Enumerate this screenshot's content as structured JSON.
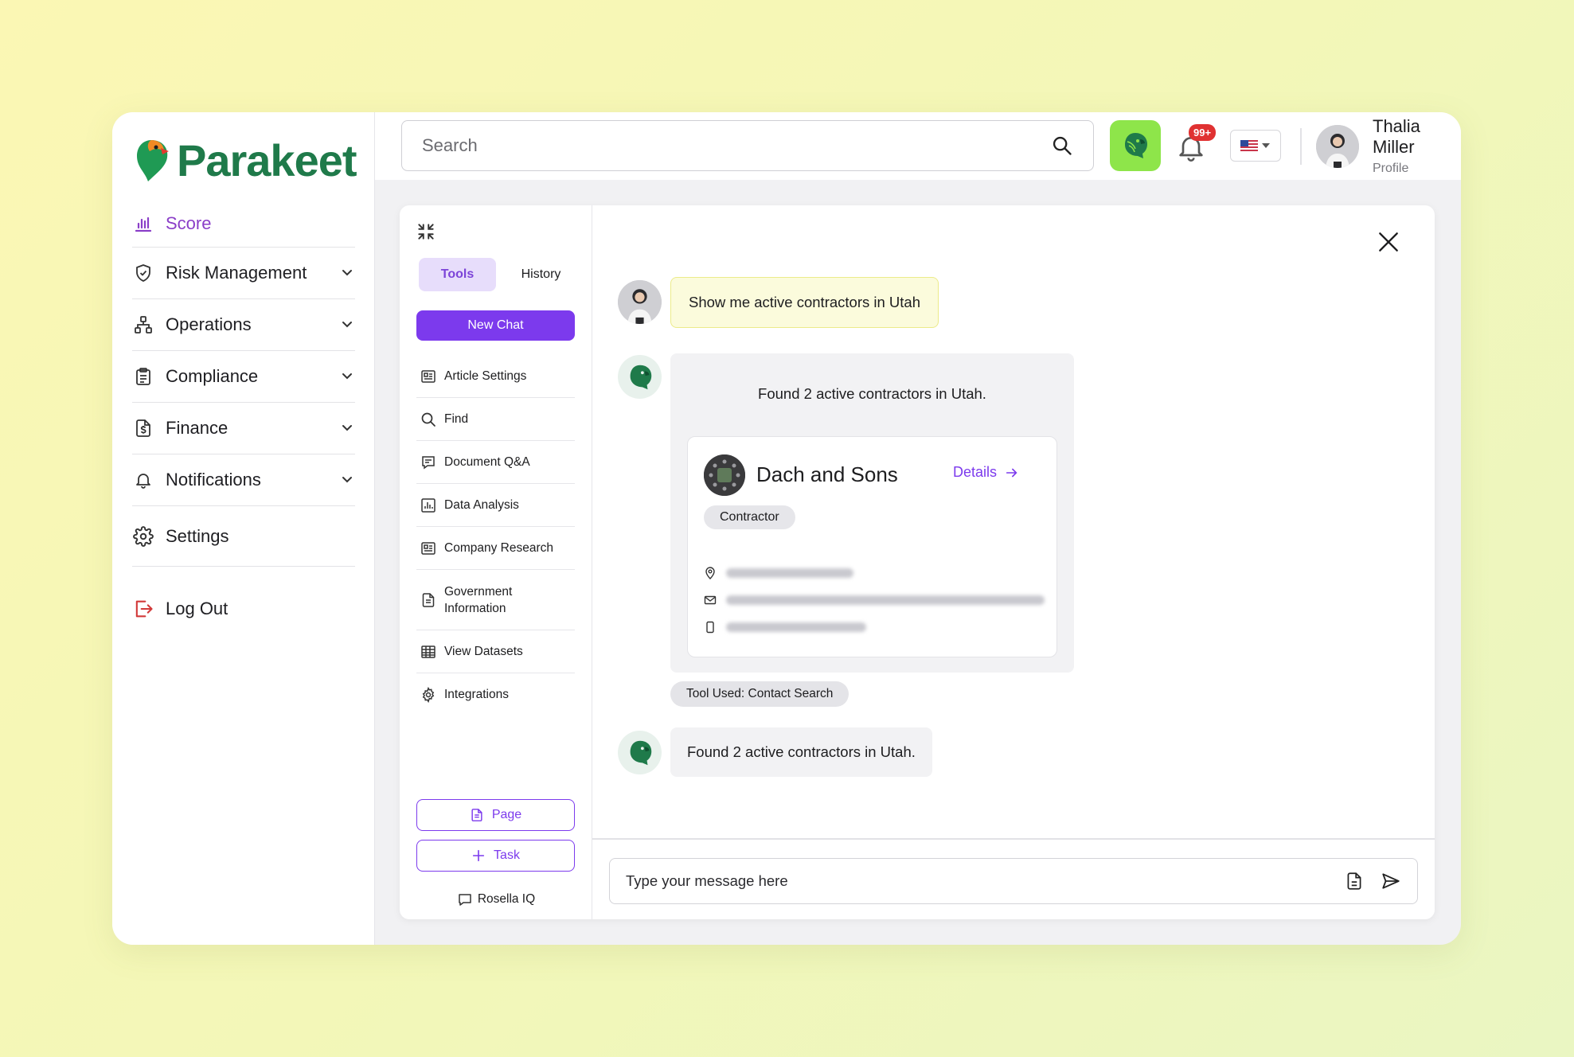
{
  "brand": {
    "name": "Parakeet"
  },
  "sidebar": {
    "items": [
      {
        "label": "Score",
        "icon": "bar-chart-icon"
      },
      {
        "label": "Risk Management",
        "icon": "shield-check-icon"
      },
      {
        "label": "Operations",
        "icon": "hierarchy-icon"
      },
      {
        "label": "Compliance",
        "icon": "clipboard-icon"
      },
      {
        "label": "Finance",
        "icon": "dollar-document-icon"
      },
      {
        "label": "Notifications",
        "icon": "bell-icon"
      },
      {
        "label": "Settings",
        "icon": "gear-icon"
      }
    ],
    "logout": "Log Out"
  },
  "topbar": {
    "search_placeholder": "Search",
    "notification_badge": "99+",
    "user": {
      "name": "Thalia Miller",
      "subtitle": "Profile"
    }
  },
  "tools_panel": {
    "tabs": [
      "Tools",
      "History"
    ],
    "new_chat": "New Chat",
    "items": [
      {
        "label": "Article Settings",
        "icon": "article-icon"
      },
      {
        "label": "Find",
        "icon": "search-icon"
      },
      {
        "label": "Document Q&A",
        "icon": "document-chat-icon"
      },
      {
        "label": "Data Analysis",
        "icon": "chart-icon"
      },
      {
        "label": "Company Research",
        "icon": "company-icon"
      },
      {
        "label": "Government Information",
        "icon": "document-icon"
      },
      {
        "label": "View Datasets",
        "icon": "table-icon"
      },
      {
        "label": "Integrations",
        "icon": "gear-icon"
      }
    ],
    "page_button": "Page",
    "task_button": "Task",
    "footer": "Rosella IQ"
  },
  "chat": {
    "user_message": "Show me active contractors in Utah",
    "bot_intro": "Found 2 active contractors in Utah.",
    "card": {
      "company": "Dach and Sons",
      "details_link": "Details",
      "tag": "Contractor"
    },
    "tool_used": "Tool Used: Contact Search",
    "bot_reply": "Found 2 active contractors in Utah.",
    "composer_placeholder": "Type your message here"
  },
  "colors": {
    "accent": "#7c3aed",
    "brand_green": "#1f7a4a",
    "parrot_button": "#8ee54a",
    "badge": "#e03131"
  }
}
